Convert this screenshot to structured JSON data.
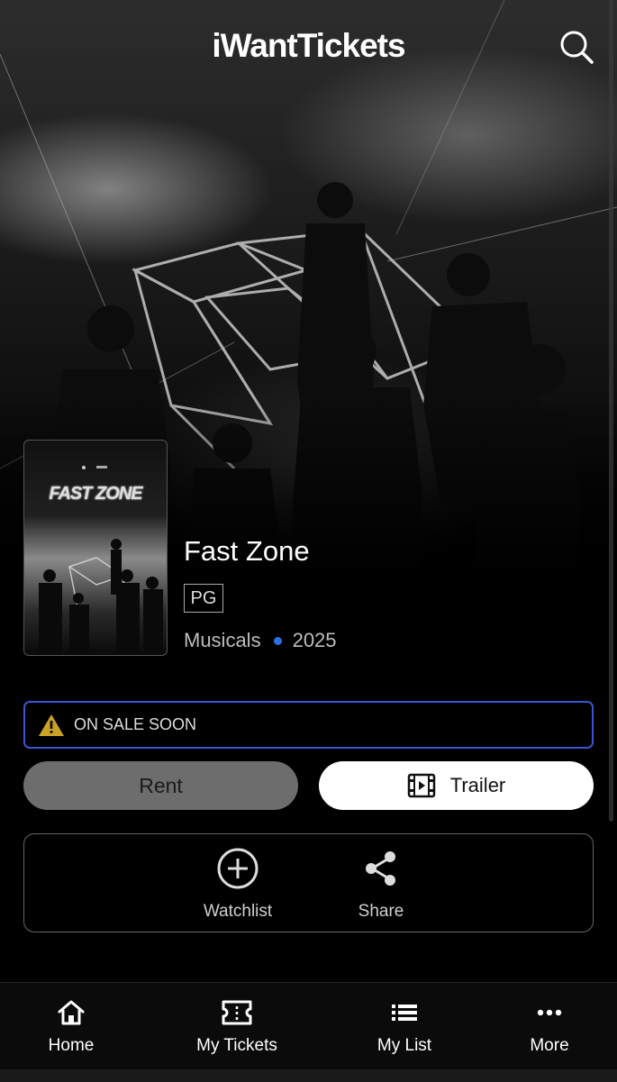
{
  "header": {
    "logo": "iWantTickets",
    "search_icon": "search-icon"
  },
  "hero": {
    "poster_title": "FAST ZONE"
  },
  "movie": {
    "title": "Fast Zone",
    "rating": "PG",
    "genre": "Musicals",
    "year": "2025"
  },
  "status_banner": {
    "text": "ON SALE SOON",
    "icon": "warning-icon",
    "accent": "#3a56d4",
    "icon_color": "#c9a227"
  },
  "buttons": {
    "rent": "Rent",
    "trailer": "Trailer"
  },
  "actions": [
    {
      "label": "Watchlist",
      "icon": "plus-circle-icon"
    },
    {
      "label": "Share",
      "icon": "share-icon"
    }
  ],
  "nav": [
    {
      "label": "Home",
      "icon": "home-icon"
    },
    {
      "label": "My Tickets",
      "icon": "ticket-icon"
    },
    {
      "label": "My List",
      "icon": "list-icon"
    },
    {
      "label": "More",
      "icon": "more-icon"
    }
  ],
  "colors": {
    "background": "#000000",
    "rent_button": "#6d6d6d",
    "trailer_button": "#ffffff",
    "genre_dot": "#2f6fe0"
  }
}
